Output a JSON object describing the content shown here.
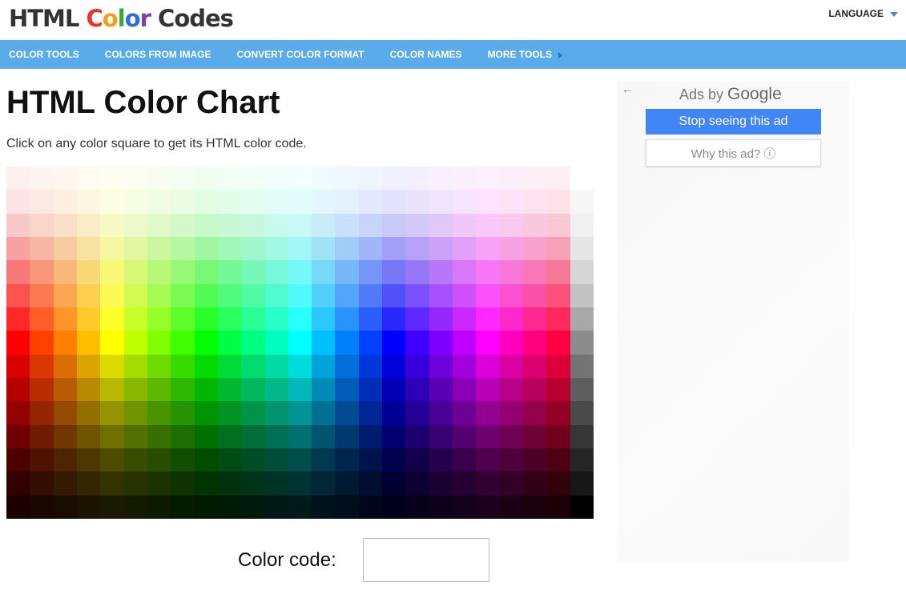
{
  "header": {
    "logo": {
      "word1": "HTML",
      "letters": [
        {
          "ch": "C",
          "color": "#e8322b"
        },
        {
          "ch": "o",
          "color": "#f2a019"
        },
        {
          "ch": "l",
          "color": "#3aa63a"
        },
        {
          "ch": "o",
          "color": "#2b6fd6"
        },
        {
          "ch": "r",
          "color": "#7e3fae"
        }
      ],
      "word3": "Codes"
    },
    "language_label": "LANGUAGE"
  },
  "nav": {
    "items": [
      "COLOR TOOLS",
      "COLORS FROM IMAGE",
      "CONVERT COLOR FORMAT",
      "COLOR NAMES",
      "MORE TOOLS"
    ]
  },
  "main": {
    "title": "HTML Color Chart",
    "intro": "Click on any color square to get its HTML color code.",
    "color_code_label": "Color code:",
    "color_code_value": ""
  },
  "palette": {
    "hue_columns": 24,
    "rows": 15,
    "gray_column": true
  },
  "ad": {
    "back_icon": "←",
    "ads_by": "Ads by",
    "google": "Google",
    "stop_label": "Stop seeing this ad",
    "why_label": "Why this ad? ⓘ"
  },
  "colors": {
    "nav_bg": "#5aabea",
    "ad_button": "#4285f4"
  }
}
